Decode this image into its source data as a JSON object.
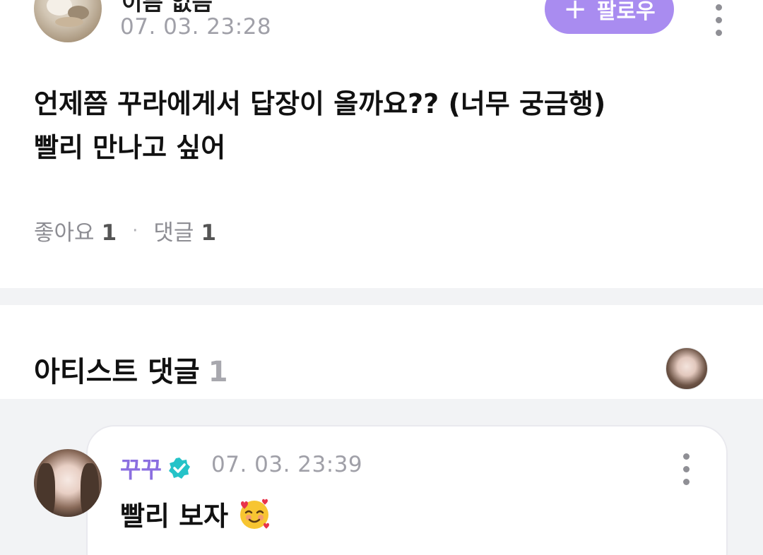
{
  "post": {
    "author_name": "이름 없음",
    "timestamp": "07. 03. 23:28",
    "follow_label": "팔로우",
    "follow_icon": "+",
    "body_lines": [
      "언제쯤 꾸라에게서 답장이 올까요?? (너무 궁금행)",
      "빨리 만나고 싶어"
    ],
    "likes_label": "좋아요",
    "likes_count": "1",
    "comments_label": "댓글",
    "comments_count": "1"
  },
  "artist_section": {
    "title": "아티스트 댓글",
    "count": "1"
  },
  "comment": {
    "author": "꾸꾸",
    "verified": true,
    "timestamp": "07. 03. 23:39",
    "text": "빨리 보자",
    "emoji": "smiling-face-with-hearts-icon"
  },
  "colors": {
    "accent": "#a98cf0",
    "artist_name": "#8b6fe0",
    "verified_badge": "#25c3c8",
    "muted_text": "#a0a0a8",
    "band": "#f2f3f5"
  }
}
